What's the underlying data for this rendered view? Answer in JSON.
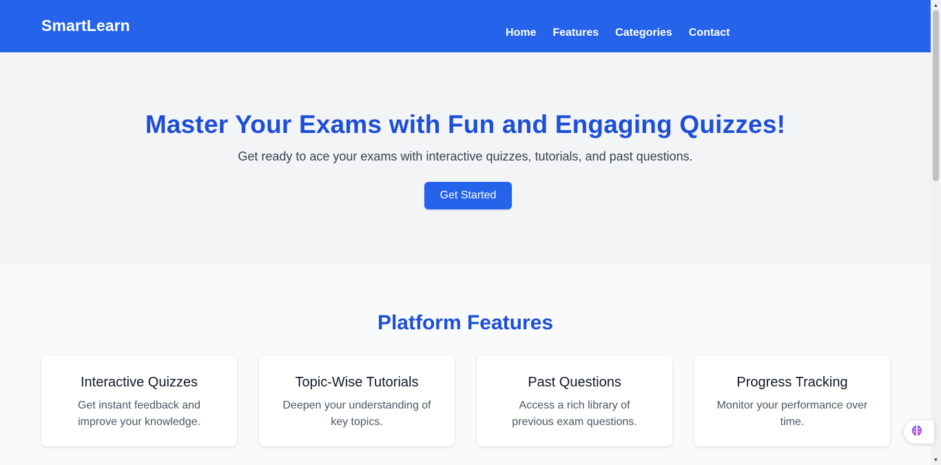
{
  "header": {
    "brand": "SmartLearn",
    "nav": [
      {
        "label": "Home"
      },
      {
        "label": "Features"
      },
      {
        "label": "Categories"
      },
      {
        "label": "Contact"
      }
    ]
  },
  "hero": {
    "title": "Master Your Exams with Fun and Engaging Quizzes!",
    "subtitle": "Get ready to ace your exams with interactive quizzes, tutorials, and past questions.",
    "cta_label": "Get Started"
  },
  "features": {
    "title": "Platform Features",
    "cards": [
      {
        "title": "Interactive Quizzes",
        "text": "Get instant feedback and improve your knowledge."
      },
      {
        "title": "Topic-Wise Tutorials",
        "text": "Deepen your understanding of key topics."
      },
      {
        "title": "Past Questions",
        "text": "Access a rich library of previous exam questions."
      },
      {
        "title": "Progress Tracking",
        "text": "Monitor your performance over time."
      }
    ]
  },
  "widget": {
    "icon": "brain-icon"
  },
  "colors": {
    "primary": "#2563eb",
    "heading": "#1d4ed8",
    "hero_bg": "#f3f4f6",
    "features_bg": "#f8fafc"
  }
}
